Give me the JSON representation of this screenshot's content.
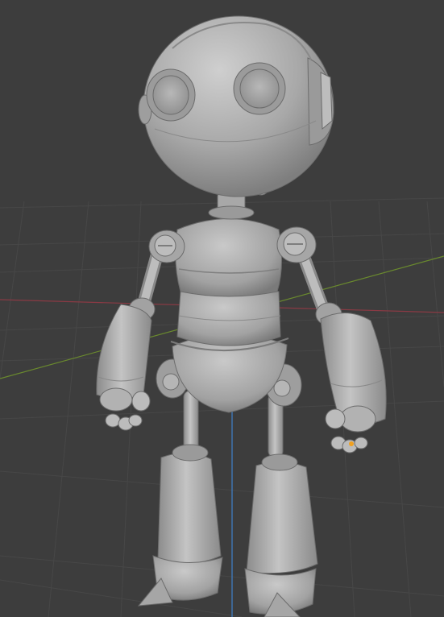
{
  "viewport": {
    "mode": "solid-shading",
    "background": "#3d3d3d",
    "grid_color": "#474747",
    "x_axis_color": "#8a3a44",
    "y_axis_color": "#6a8a2e",
    "z_axis_color": "#3f78b8",
    "model_color": "#a9a9a9",
    "selected_object_origin_color": "#f0a020"
  },
  "scene_object": {
    "name": "robot-character",
    "description_icon": "robot-icon"
  }
}
